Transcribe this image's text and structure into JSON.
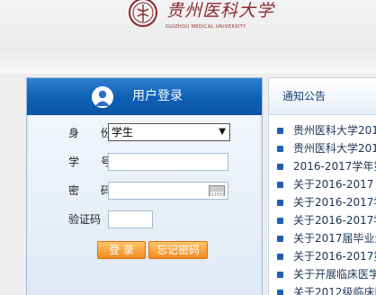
{
  "header": {
    "university_name": "贵州医科大学",
    "university_name_en": "GUIZHOU MEDICAL UNIVERSITY"
  },
  "login": {
    "title": "用户登录",
    "identity_label": "身 份",
    "identity_value": "学生",
    "student_id_label": "学 号",
    "student_id_value": "",
    "password_label": "密 码",
    "password_value": "",
    "captcha_label": "验证码",
    "captcha_value": "",
    "login_button": "登 录",
    "forgot_button": "忘记密码"
  },
  "notice": {
    "title": "通知公告",
    "items": [
      "贵州医科大学201",
      "贵州医科大学201",
      "2016-2017学年第",
      "关于2016-2017（",
      "关于2016-2017学",
      "关于2016-2017学",
      "关于2017届毕业生",
      "关于2016-2017第",
      "关于开展临床医学",
      "关于2012级临床医"
    ]
  },
  "colors": {
    "login_header": "#0d5fb5",
    "button_orange": "#f38a1e",
    "logo_red": "#8a2a2f"
  }
}
